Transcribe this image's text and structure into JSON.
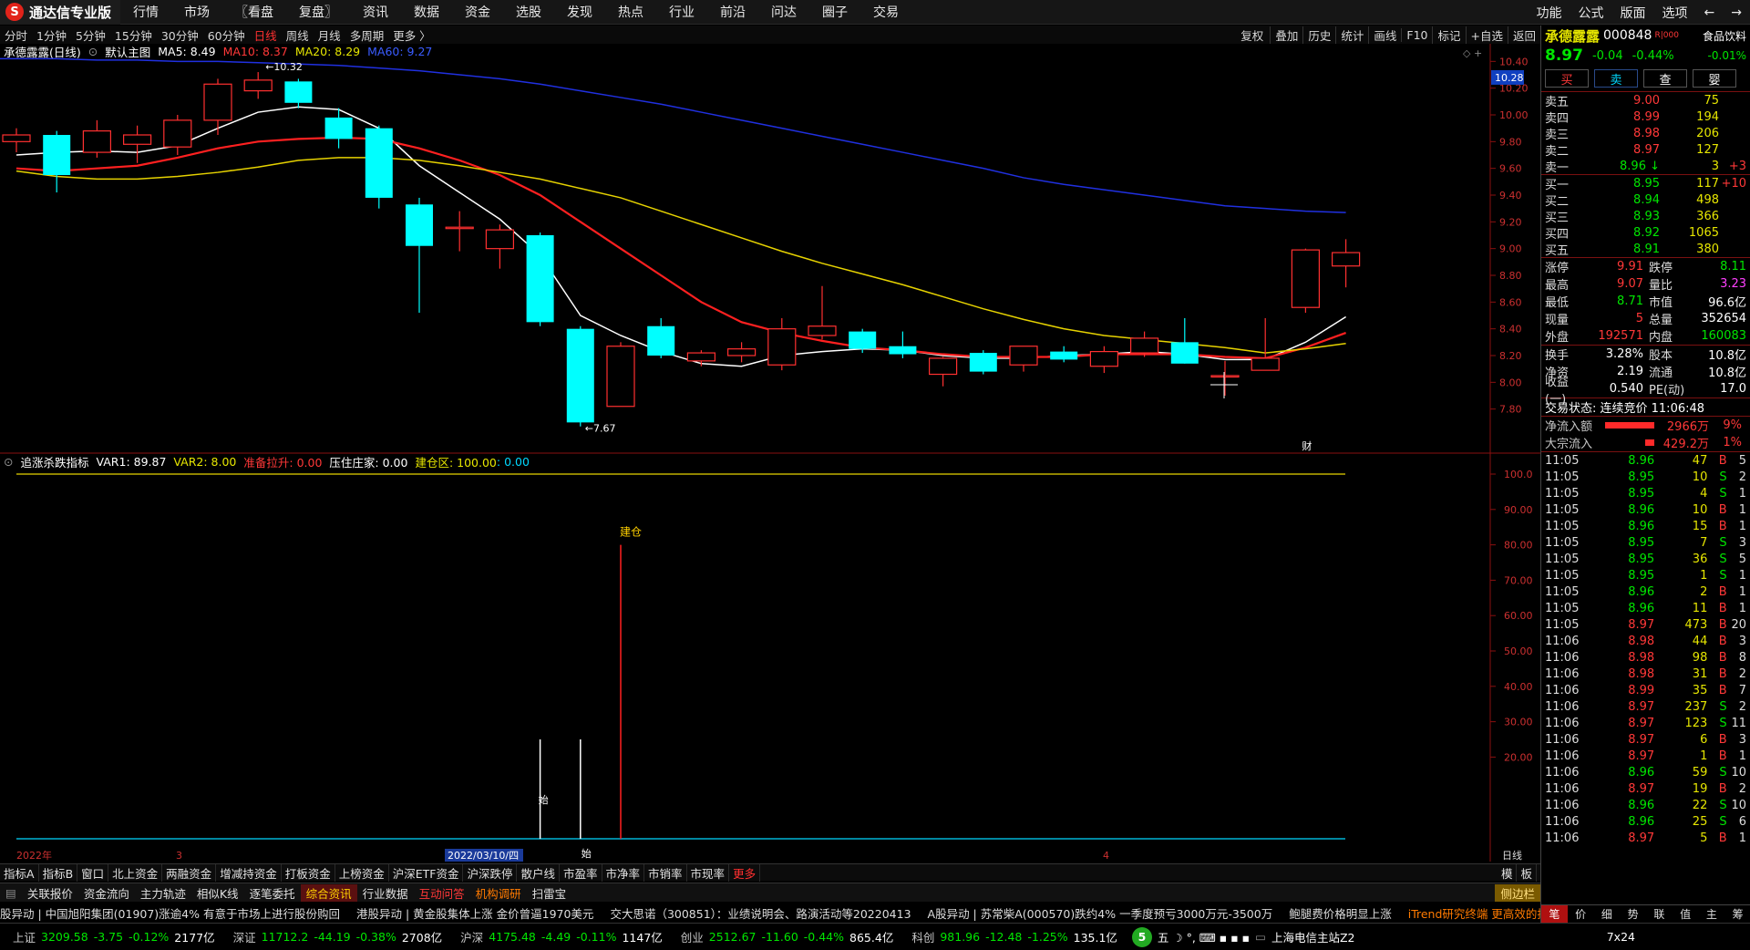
{
  "app": {
    "title": "通达信专业版",
    "logo": "S"
  },
  "menu": [
    "行情",
    "市场",
    "〖看盘",
    "复盘〗",
    "资讯",
    "数据",
    "资金",
    "选股",
    "发现",
    "热点",
    "行业",
    "前沿",
    "问达",
    "圈子",
    "交易"
  ],
  "menu_right": [
    "功能",
    "公式",
    "版面",
    "选项",
    "←",
    "→"
  ],
  "toolbar": {
    "periods": [
      "分时",
      "1分钟",
      "5分钟",
      "15分钟",
      "30分钟",
      "60分钟",
      "日线",
      "周线",
      "月线",
      "多周期",
      "更多 〉"
    ],
    "active": "日线",
    "right": [
      "复权",
      "叠加",
      "历史",
      "统计",
      "画线",
      "F10",
      "标记",
      "+自选",
      "返回"
    ]
  },
  "info": {
    "name": "承德露露(日线)",
    "template": "默认主图",
    "ma5": "MA5: 8.49",
    "ma10": "MA10: 8.37",
    "ma20": "MA20: 8.29",
    "ma60": "MA60: 9.27"
  },
  "chart_data": {
    "type": "candlestick",
    "title": "承德露露(日线)",
    "ylim": [
      7.6,
      10.45
    ],
    "y_ticks": [
      "10.40",
      "10.20",
      "10.00",
      "9.80",
      "9.60",
      "9.40",
      "9.20",
      "9.00",
      "8.80",
      "8.60",
      "8.40",
      "8.20",
      "8.00",
      "7.80"
    ],
    "current_price_tag": "10.28",
    "annotations": {
      "high": "10.32",
      "low": "7.67",
      "marker": "财"
    },
    "candles": [
      {
        "o": 9.8,
        "c": 9.85,
        "h": 9.9,
        "l": 9.72
      },
      {
        "o": 9.85,
        "c": 9.55,
        "h": 9.88,
        "l": 9.42
      },
      {
        "o": 9.72,
        "c": 9.88,
        "h": 9.96,
        "l": 9.68
      },
      {
        "o": 9.78,
        "c": 9.85,
        "h": 9.92,
        "l": 9.64
      },
      {
        "o": 9.76,
        "c": 9.96,
        "h": 10.0,
        "l": 9.7
      },
      {
        "o": 9.96,
        "c": 10.23,
        "h": 10.27,
        "l": 9.85
      },
      {
        "o": 10.18,
        "c": 10.26,
        "h": 10.32,
        "l": 10.12
      },
      {
        "o": 10.25,
        "c": 10.09,
        "h": 10.27,
        "l": 10.05
      },
      {
        "o": 9.98,
        "c": 9.82,
        "h": 10.05,
        "l": 9.75
      },
      {
        "o": 9.9,
        "c": 9.38,
        "h": 9.92,
        "l": 9.3
      },
      {
        "o": 9.33,
        "c": 9.02,
        "h": 9.38,
        "l": 8.52
      },
      {
        "o": 9.15,
        "c": 9.16,
        "h": 9.28,
        "l": 8.98
      },
      {
        "o": 9.0,
        "c": 9.14,
        "h": 9.18,
        "l": 8.85
      },
      {
        "o": 9.1,
        "c": 8.45,
        "h": 9.12,
        "l": 8.42
      },
      {
        "o": 8.4,
        "c": 7.7,
        "h": 8.42,
        "l": 7.67
      },
      {
        "o": 7.82,
        "c": 8.27,
        "h": 8.3,
        "l": 7.82
      },
      {
        "o": 8.42,
        "c": 8.2,
        "h": 8.48,
        "l": 8.18
      },
      {
        "o": 8.16,
        "c": 8.22,
        "h": 8.24,
        "l": 8.12
      },
      {
        "o": 8.2,
        "c": 8.25,
        "h": 8.3,
        "l": 8.15
      },
      {
        "o": 8.13,
        "c": 8.4,
        "h": 8.48,
        "l": 8.09
      },
      {
        "o": 8.35,
        "c": 8.42,
        "h": 8.72,
        "l": 8.32
      },
      {
        "o": 8.38,
        "c": 8.25,
        "h": 8.4,
        "l": 8.22
      },
      {
        "o": 8.27,
        "c": 8.21,
        "h": 8.38,
        "l": 8.18
      },
      {
        "o": 8.06,
        "c": 8.18,
        "h": 8.19,
        "l": 7.97
      },
      {
        "o": 8.22,
        "c": 8.08,
        "h": 8.24,
        "l": 8.06
      },
      {
        "o": 8.13,
        "c": 8.27,
        "h": 8.27,
        "l": 8.08
      },
      {
        "o": 8.23,
        "c": 8.17,
        "h": 8.27,
        "l": 8.15
      },
      {
        "o": 8.12,
        "c": 8.23,
        "h": 8.27,
        "l": 8.07
      },
      {
        "o": 8.22,
        "c": 8.33,
        "h": 8.38,
        "l": 8.19
      },
      {
        "o": 8.3,
        "c": 8.14,
        "h": 8.48,
        "l": 8.14
      },
      {
        "o": 8.05,
        "c": 8.05,
        "h": 8.16,
        "l": 7.9
      },
      {
        "o": 8.09,
        "c": 8.18,
        "h": 8.48,
        "l": 8.09
      },
      {
        "o": 8.56,
        "c": 8.99,
        "h": 9.0,
        "l": 8.52
      },
      {
        "o": 8.87,
        "c": 8.97,
        "h": 9.07,
        "l": 8.71
      }
    ],
    "series": [
      {
        "name": "MA5",
        "color": "#ffffff",
        "values": [
          9.7,
          9.72,
          9.73,
          9.72,
          9.77,
          9.9,
          10.02,
          10.06,
          10.04,
          9.9,
          9.62,
          9.42,
          9.22,
          8.95,
          8.5,
          8.35,
          8.23,
          8.14,
          8.12,
          8.2,
          8.23,
          8.25,
          8.24,
          8.2,
          8.18,
          8.18,
          8.2,
          8.21,
          8.23,
          8.21,
          8.17,
          8.17,
          8.3,
          8.49
        ]
      },
      {
        "name": "MA10",
        "color": "#ff2020",
        "values": [
          9.6,
          9.58,
          9.6,
          9.62,
          9.68,
          9.75,
          9.8,
          9.82,
          9.83,
          9.82,
          9.75,
          9.66,
          9.55,
          9.4,
          9.2,
          9.0,
          8.8,
          8.6,
          8.45,
          8.37,
          8.31,
          8.26,
          8.24,
          8.21,
          8.19,
          8.19,
          8.19,
          8.21,
          8.21,
          8.21,
          8.19,
          8.18,
          8.26,
          8.37
        ]
      },
      {
        "name": "MA20",
        "color": "#e6d200",
        "values": [
          9.58,
          9.54,
          9.52,
          9.52,
          9.54,
          9.57,
          9.61,
          9.66,
          9.68,
          9.68,
          9.66,
          9.62,
          9.57,
          9.52,
          9.45,
          9.38,
          9.28,
          9.18,
          9.08,
          8.98,
          8.89,
          8.81,
          8.73,
          8.64,
          8.55,
          8.47,
          8.4,
          8.35,
          8.32,
          8.29,
          8.26,
          8.22,
          8.25,
          8.29
        ]
      },
      {
        "name": "MA60",
        "color": "#2030e0",
        "values": [
          10.42,
          10.42,
          10.41,
          10.41,
          10.4,
          10.4,
          10.39,
          10.38,
          10.37,
          10.35,
          10.33,
          10.3,
          10.27,
          10.23,
          10.18,
          10.13,
          10.08,
          10.02,
          9.96,
          9.9,
          9.84,
          9.78,
          9.72,
          9.66,
          9.6,
          9.53,
          9.48,
          9.44,
          9.4,
          9.36,
          9.32,
          9.3,
          9.28,
          9.27
        ]
      }
    ]
  },
  "sub_chart": {
    "title": "追涨杀跌指标",
    "var1": "VAR1: 89.87",
    "var2": "VAR2: 8.00",
    "label3": "准备拉升: 0.00",
    "label4": "压住庄家: 0.00",
    "label5": "建仓区: 100.00",
    "label6": ": 0.00",
    "y_ticks": [
      "100.0",
      "90.00",
      "80.00",
      "70.00",
      "60.00",
      "50.00",
      "40.00",
      "30.00",
      "20.00"
    ],
    "marks": {
      "jc": "建仓",
      "shi1": "始",
      "shi2": "始"
    },
    "signals": [
      {
        "idx": 13,
        "value": 25,
        "color": "#ffffff"
      },
      {
        "idx": 14,
        "value": 25,
        "color": "#ffffff"
      },
      {
        "idx": 15,
        "value": 80,
        "color": "#ff2020"
      }
    ]
  },
  "date_axis": {
    "d1": "2022年",
    "d2": "3",
    "d3": "2022/03/10/四",
    "d4": "4",
    "period": "日线"
  },
  "bottom_tabs": [
    "指标A",
    "指标B",
    "窗口",
    "北上资金",
    "两融资金",
    "增减持资金",
    "打板资金",
    "上榜资金",
    "沪深ETF资金",
    "沪深跌停",
    "散户线",
    "市盈率",
    "市净率",
    "市销率",
    "市现率",
    "更多"
  ],
  "bottom_tabs_right": [
    "模",
    "板"
  ],
  "bottom_tabs2": [
    "关联报价",
    "资金流向",
    "主力轨迹",
    "相似K线",
    "逐笔委托",
    "综合资讯",
    "行业数据",
    "互动问答",
    "机构调研",
    "扫雷宝"
  ],
  "side_tabs_label": "侧边栏",
  "ticker": [
    "股异动 | 中国旭阳集团(01907)涨逾4% 有意于市场上进行股份购回",
    "港股异动 | 黄金股集体上涨 金价曾逼1970美元",
    "交大思诺（300851）：业绩说明会、路演活动等20220413",
    "A股异动 | 苏常柴A(000570)跌约4% 一季度预亏3000万元-3500万",
    "鲍腿费价格明显上涨",
    "iTrend研究终端 更高效的投研体验"
  ],
  "status": [
    {
      "name": "上证",
      "val": "3209.58",
      "chg": "-3.75",
      "pct": "-0.12%",
      "amt": "2177亿"
    },
    {
      "name": "深证",
      "val": "11712.2",
      "chg": "-44.19",
      "pct": "-0.38%",
      "amt": "2708亿"
    },
    {
      "name": "沪深",
      "val": "4175.48",
      "chg": "-4.49",
      "pct": "-0.11%",
      "amt": "1147亿"
    },
    {
      "name": "创业",
      "val": "2512.67",
      "chg": "-11.60",
      "pct": "-0.44%",
      "amt": "865.4亿"
    },
    {
      "name": "科创",
      "val": "981.96",
      "chg": "-12.48",
      "pct": "-1.25%",
      "amt": "135.1亿"
    }
  ],
  "status_right": {
    "server": "上海电信主站Z2",
    "clock": "7x24"
  },
  "panel": {
    "name": "承德露露",
    "code": "000848",
    "rz": "R|000",
    "sector": "食品饮料",
    "price": "8.97",
    "chg": "-0.04",
    "pct": "-0.44%",
    "sector_pct": "-0.01%",
    "buttons": [
      "买",
      "卖",
      "查",
      "婴"
    ],
    "asks": [
      {
        "l": "卖五",
        "p": "9.00",
        "v": "75",
        "d": ""
      },
      {
        "l": "卖四",
        "p": "8.99",
        "v": "194",
        "d": ""
      },
      {
        "l": "卖三",
        "p": "8.98",
        "v": "206",
        "d": ""
      },
      {
        "l": "卖二",
        "p": "8.97",
        "v": "127",
        "d": ""
      },
      {
        "l": "卖一",
        "p": "8.96 ↓",
        "v": "3",
        "d": "+3"
      }
    ],
    "bids": [
      {
        "l": "买一",
        "p": "8.95",
        "v": "117",
        "d": "+10"
      },
      {
        "l": "买二",
        "p": "8.94",
        "v": "498",
        "d": ""
      },
      {
        "l": "买三",
        "p": "8.93",
        "v": "366",
        "d": ""
      },
      {
        "l": "买四",
        "p": "8.92",
        "v": "1065",
        "d": ""
      },
      {
        "l": "买五",
        "p": "8.91",
        "v": "380",
        "d": ""
      }
    ],
    "stats": [
      {
        "k": "涨停",
        "v": "9.91",
        "k2": "跌停",
        "v2": "8.11"
      },
      {
        "k": "最高",
        "v": "9.07",
        "k2": "量比",
        "v2": "3.23"
      },
      {
        "k": "最低",
        "v": "8.71",
        "k2": "市值",
        "v2": "96.6亿"
      },
      {
        "k": "现量",
        "v": "5",
        "k2": "总量",
        "v2": "352654"
      },
      {
        "k": "外盘",
        "v": "192571",
        "k2": "内盘",
        "v2": "160083"
      }
    ],
    "stats2": [
      {
        "k": "换手",
        "v": "3.28%",
        "k2": "股本",
        "v2": "10.8亿"
      },
      {
        "k": "净资",
        "v": "2.19",
        "k2": "流通",
        "v2": "10.8亿"
      },
      {
        "k": "收益(一)",
        "v": "0.540",
        "k2": "PE(动)",
        "v2": "17.0"
      }
    ],
    "trade_status": "交易状态: 连续竞价 11:06:48",
    "flow": [
      {
        "k": "净流入额",
        "v": "2966万",
        "p": "9%"
      },
      {
        "k": "大宗流入",
        "v": "429.2万",
        "p": "1%"
      }
    ],
    "ticks": [
      {
        "t": "11:05",
        "p": "8.96",
        "v": "47",
        "d": "B",
        "n": "5"
      },
      {
        "t": "11:05",
        "p": "8.95",
        "v": "10",
        "d": "S",
        "n": "2"
      },
      {
        "t": "11:05",
        "p": "8.95",
        "v": "4",
        "d": "S",
        "n": "1"
      },
      {
        "t": "11:05",
        "p": "8.96",
        "v": "10",
        "d": "B",
        "n": "1"
      },
      {
        "t": "11:05",
        "p": "8.96",
        "v": "15",
        "d": "B",
        "n": "1"
      },
      {
        "t": "11:05",
        "p": "8.95",
        "v": "7",
        "d": "S",
        "n": "3"
      },
      {
        "t": "11:05",
        "p": "8.95",
        "v": "36",
        "d": "S",
        "n": "5"
      },
      {
        "t": "11:05",
        "p": "8.95",
        "v": "1",
        "d": "S",
        "n": "1"
      },
      {
        "t": "11:05",
        "p": "8.96",
        "v": "2",
        "d": "B",
        "n": "1"
      },
      {
        "t": "11:05",
        "p": "8.96",
        "v": "11",
        "d": "B",
        "n": "1"
      },
      {
        "t": "11:05",
        "p": "8.97",
        "v": "473",
        "d": "B",
        "n": "20"
      },
      {
        "t": "11:06",
        "p": "8.98",
        "v": "44",
        "d": "B",
        "n": "3"
      },
      {
        "t": "11:06",
        "p": "8.98",
        "v": "98",
        "d": "B",
        "n": "8"
      },
      {
        "t": "11:06",
        "p": "8.98",
        "v": "31",
        "d": "B",
        "n": "2"
      },
      {
        "t": "11:06",
        "p": "8.99",
        "v": "35",
        "d": "B",
        "n": "7"
      },
      {
        "t": "11:06",
        "p": "8.97",
        "v": "237",
        "d": "S",
        "n": "2"
      },
      {
        "t": "11:06",
        "p": "8.97",
        "v": "123",
        "d": "S",
        "n": "11"
      },
      {
        "t": "11:06",
        "p": "8.97",
        "v": "6",
        "d": "B",
        "n": "3"
      },
      {
        "t": "11:06",
        "p": "8.97",
        "v": "1",
        "d": "B",
        "n": "1"
      },
      {
        "t": "11:06",
        "p": "8.96",
        "v": "59",
        "d": "S",
        "n": "10"
      },
      {
        "t": "11:06",
        "p": "8.97",
        "v": "19",
        "d": "B",
        "n": "2"
      },
      {
        "t": "11:06",
        "p": "8.96",
        "v": "22",
        "d": "S",
        "n": "10"
      },
      {
        "t": "11:06",
        "p": "8.96",
        "v": "25",
        "d": "S",
        "n": "6"
      },
      {
        "t": "11:06",
        "p": "8.97",
        "v": "5",
        "d": "B",
        "n": "1"
      }
    ],
    "bottom_tabs": [
      "笔",
      "价",
      "细",
      "势",
      "联",
      "值",
      "主",
      "筹"
    ]
  }
}
